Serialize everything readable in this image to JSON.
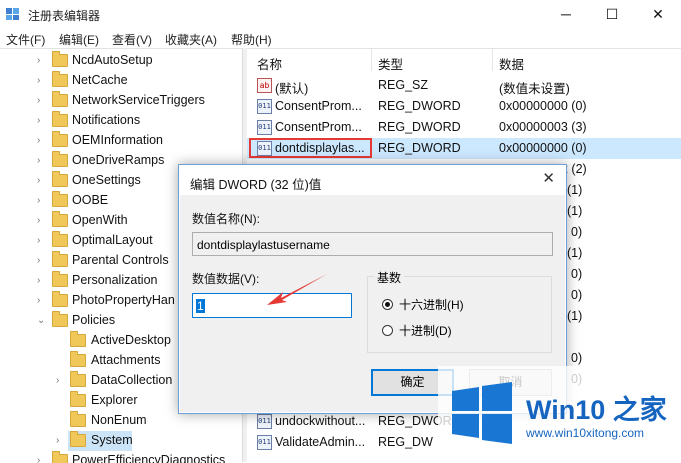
{
  "window": {
    "title": "注册表编辑器"
  },
  "menu": [
    "文件(F)",
    "编辑(E)",
    "查看(V)",
    "收藏夹(A)",
    "帮助(H)"
  ],
  "tree": [
    {
      "label": "NcdAutoSetup"
    },
    {
      "label": "NetCache"
    },
    {
      "label": "NetworkServiceTriggers"
    },
    {
      "label": "Notifications"
    },
    {
      "label": "OEMInformation"
    },
    {
      "label": "OneDriveRamps"
    },
    {
      "label": "OneSettings"
    },
    {
      "label": "OOBE"
    },
    {
      "label": "OpenWith"
    },
    {
      "label": "OptimalLayout"
    },
    {
      "label": "Parental Controls"
    },
    {
      "label": "Personalization"
    },
    {
      "label": "PhotoPropertyHan"
    },
    {
      "label": "Policies"
    },
    {
      "label": "ActiveDesktop"
    },
    {
      "label": "Attachments"
    },
    {
      "label": "DataCollection"
    },
    {
      "label": "Explorer"
    },
    {
      "label": "NonEnum"
    },
    {
      "label": "System"
    },
    {
      "label": "PowerEfficiencyDiagnostics"
    }
  ],
  "columns": {
    "name": "名称",
    "type": "类型",
    "data": "数据"
  },
  "values": [
    {
      "name": "(默认)",
      "type": "REG_SZ",
      "data": "(数值未设置)",
      "icon": "ab"
    },
    {
      "name": "ConsentProm...",
      "type": "REG_DWORD",
      "data": "0x00000000 (0)",
      "icon": "binary"
    },
    {
      "name": "ConsentProm...",
      "type": "REG_DWORD",
      "data": "0x00000003 (3)",
      "icon": "binary"
    },
    {
      "name": "dontdisplaylas...",
      "type": "REG_DWORD",
      "data": "0x00000000 (0)",
      "icon": "binary"
    },
    {
      "name": "",
      "type": "",
      "data": "2 (2)",
      "icon": "binary"
    },
    {
      "name": "",
      "type": "",
      "data": "(1)",
      "icon": "binary"
    },
    {
      "name": "",
      "type": "",
      "data": "(1)",
      "icon": "binary"
    },
    {
      "name": "",
      "type": "",
      "data": "0)",
      "icon": "binary"
    },
    {
      "name": "",
      "type": "",
      "data": "(1)",
      "icon": "binary"
    },
    {
      "name": "",
      "type": "",
      "data": "0)",
      "icon": "binary"
    },
    {
      "name": "",
      "type": "",
      "data": "0)",
      "icon": "binary"
    },
    {
      "name": "",
      "type": "",
      "data": "(1)",
      "icon": "binary"
    },
    {
      "name": "",
      "type": "",
      "data": "",
      "icon": "binary"
    },
    {
      "name": "",
      "type": "",
      "data": "",
      "icon": "binary"
    },
    {
      "name": "",
      "type": "",
      "data": "0)",
      "icon": "binary"
    },
    {
      "name": "",
      "type": "",
      "data": "0)",
      "icon": "binary"
    },
    {
      "name": "undockwithout...",
      "type": "REG_DWORD",
      "data": "",
      "icon": "binary"
    },
    {
      "name": "ValidateAdmin...",
      "type": "REG_DW",
      "data": "",
      "icon": "binary"
    }
  ],
  "dialog": {
    "title": "编辑 DWORD (32 位)值",
    "name_label": "数值名称(N):",
    "name_value": "dontdisplaylastusername",
    "data_label": "数值数据(V):",
    "data_value": "1",
    "base_label": "基数",
    "hex_label": "十六进制(H)",
    "dec_label": "十进制(D)",
    "ok": "确定",
    "cancel": "取消",
    "selected_base": "hex"
  },
  "watermark": {
    "title": "Win10 之家",
    "url": "www.win10xitong.com"
  },
  "colors": {
    "selection": "#cce8ff",
    "highlight_box": "#e53935",
    "accent": "#0078d7",
    "watermark": "#1565c0",
    "arrow": "#e53935"
  }
}
